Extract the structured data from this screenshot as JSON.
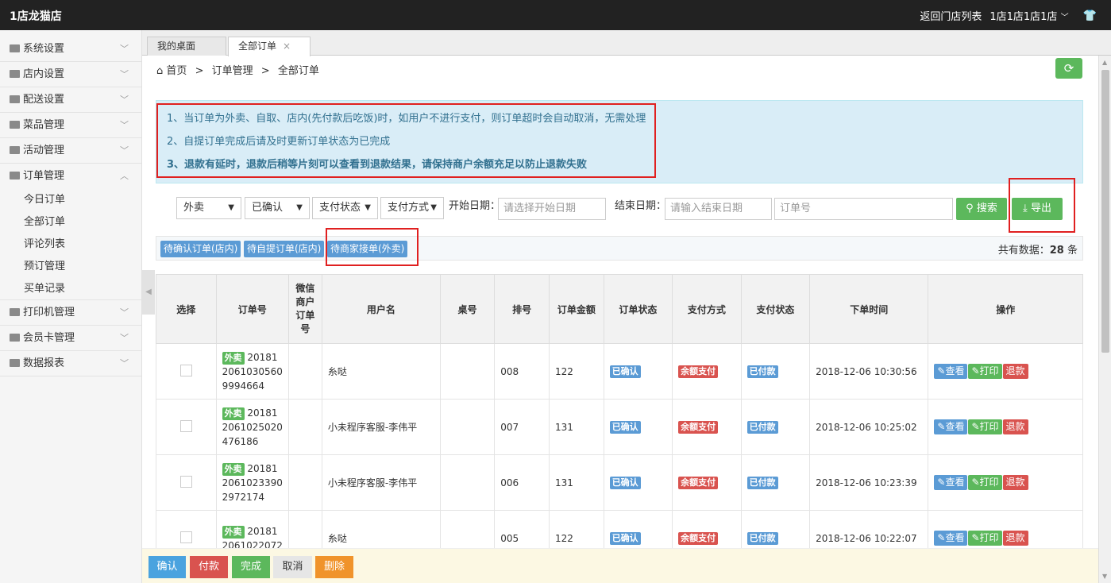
{
  "header": {
    "brand": "1店龙猫店",
    "back_link": "返回门店列表",
    "store_name": "1店1店1店1店"
  },
  "sidebar": {
    "items": [
      {
        "label": "系统设置",
        "icon": "list-icon"
      },
      {
        "label": "店内设置",
        "icon": "image-icon"
      },
      {
        "label": "配送设置",
        "icon": "truck-icon"
      },
      {
        "label": "菜品管理",
        "icon": "image-icon"
      },
      {
        "label": "活动管理",
        "icon": "image-icon"
      },
      {
        "label": "订单管理",
        "icon": "document-icon"
      },
      {
        "label": "打印机管理",
        "icon": "printer-icon"
      },
      {
        "label": "会员卡管理",
        "icon": "user-icon"
      },
      {
        "label": "数据报表",
        "icon": "chart-icon"
      }
    ],
    "subitems": [
      "今日订单",
      "全部订单",
      "评论列表",
      "预订管理",
      "买单记录"
    ]
  },
  "tabs": [
    {
      "label": "我的桌面"
    },
    {
      "label": "全部订单"
    }
  ],
  "breadcrumb": {
    "home": "首页",
    "sep": ">",
    "level1": "订单管理",
    "level2": "全部订单"
  },
  "notice": {
    "line1": "1、当订单为外卖、自取、店内(先付款后吃饭)时，如用户不进行支付，则订单超时会自动取消，无需处理",
    "line2": "2、自提订单完成后请及时更新订单状态为已完成",
    "line3": "3、退款有延时，退款后稍等片刻可以查看到退款结果，请保持商户余额充足以防止退款失败"
  },
  "filters": {
    "type": "外卖",
    "confirm": "已确认",
    "pay_status": "支付状态",
    "pay_method": "支付方式",
    "start_label": "开始日期：",
    "start_placeholder": "请选择开始日期",
    "end_label": "结束日期：",
    "end_placeholder": "请输入结束日期",
    "order_placeholder": "订单号",
    "search": "搜索",
    "export": "导出"
  },
  "quick": {
    "btn1": "待确认订单(店内)",
    "btn2": "待自提订单(店内)",
    "btn3": "待商家接单(外卖)",
    "total_label": "共有数据：",
    "total_count": "28",
    "total_unit": "条"
  },
  "table": {
    "headers": [
      "选择",
      "订单号",
      "微信商户订单号",
      "用户名",
      "桌号",
      "排号",
      "订单金额",
      "订单状态",
      "支付方式",
      "支付状态",
      "下单时间",
      "操作"
    ],
    "rows": [
      {
        "type": "外卖",
        "order_l1": "20181",
        "order_l2": "2061030560",
        "order_l3": "9994664",
        "user": "糸哒",
        "queue": "008",
        "amount": "122",
        "status": "已确认",
        "method": "余额支付",
        "paid": "已付款",
        "time": "2018-12-06 10:30:56"
      },
      {
        "type": "外卖",
        "order_l1": "20181",
        "order_l2": "2061025020",
        "order_l3": "476186",
        "user": "小未程序客服-李伟平",
        "queue": "007",
        "amount": "131",
        "status": "已确认",
        "method": "余额支付",
        "paid": "已付款",
        "time": "2018-12-06 10:25:02"
      },
      {
        "type": "外卖",
        "order_l1": "20181",
        "order_l2": "2061023390",
        "order_l3": "2972174",
        "user": "小未程序客服-李伟平",
        "queue": "006",
        "amount": "131",
        "status": "已确认",
        "method": "余额支付",
        "paid": "已付款",
        "time": "2018-12-06 10:23:39"
      },
      {
        "type": "外卖",
        "order_l1": "20181",
        "order_l2": "2061022072",
        "order_l3": "",
        "user": "糸哒",
        "queue": "005",
        "amount": "122",
        "status": "已确认",
        "method": "余额支付",
        "paid": "已付款",
        "time": "2018-12-06 10:22:07"
      }
    ],
    "actions": {
      "view": "查看",
      "print": "打印",
      "refund": "退款"
    }
  },
  "bottom": {
    "confirm": "确认",
    "pay": "付款",
    "complete": "完成",
    "cancel": "取消",
    "delete": "删除"
  },
  "colors": {
    "green": "#5cb85c",
    "blue": "#5b9bd5",
    "red": "#d9534f",
    "orange": "#f0932b",
    "highlight": "#e02020"
  }
}
